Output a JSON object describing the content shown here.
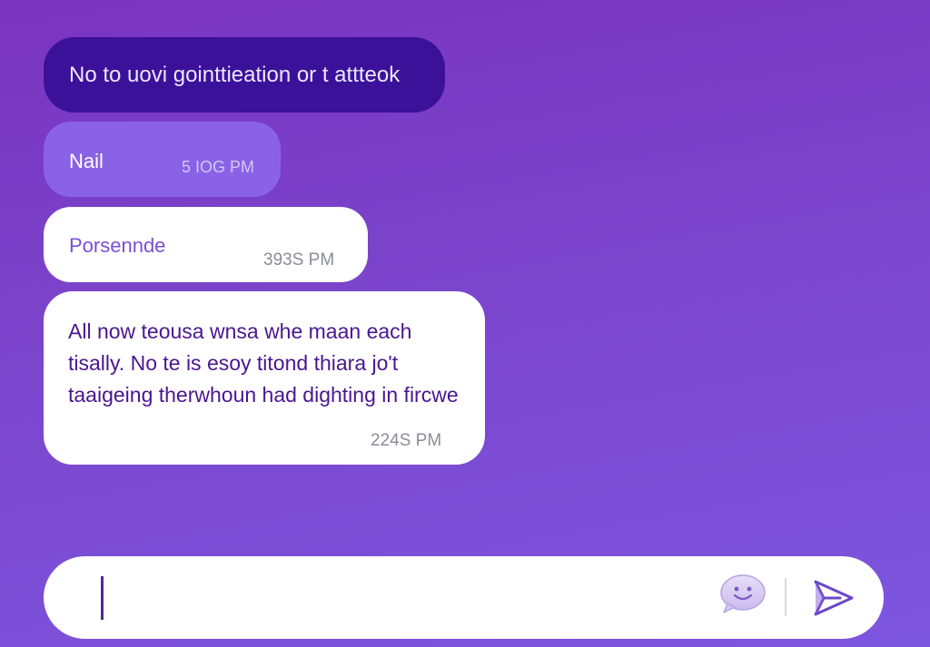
{
  "messages": [
    {
      "text": "No to uovi gointtieation or t attteok",
      "time": ""
    },
    {
      "text": "Nail",
      "time": "5 IOG PM"
    },
    {
      "text": "Porsennde",
      "time": "393S PM"
    },
    {
      "text": "All now teousa wnsa whe maan each tisally. No te is esoy titond thiara jo't taaigeing therwhoun had dighting in fircwe",
      "time": "224S PM"
    }
  ],
  "composer": {
    "value": "",
    "placeholder": "",
    "emoji_icon": "smiley-chat-icon",
    "send_icon": "send-arrow-icon"
  },
  "colors": {
    "background_top": "#7a34bf",
    "background_bottom": "#7d56e0",
    "sent_dark": "#3c119a",
    "sent_light": "#8a62e6",
    "received": "#ffffff",
    "accent": "#7a4fd4"
  }
}
